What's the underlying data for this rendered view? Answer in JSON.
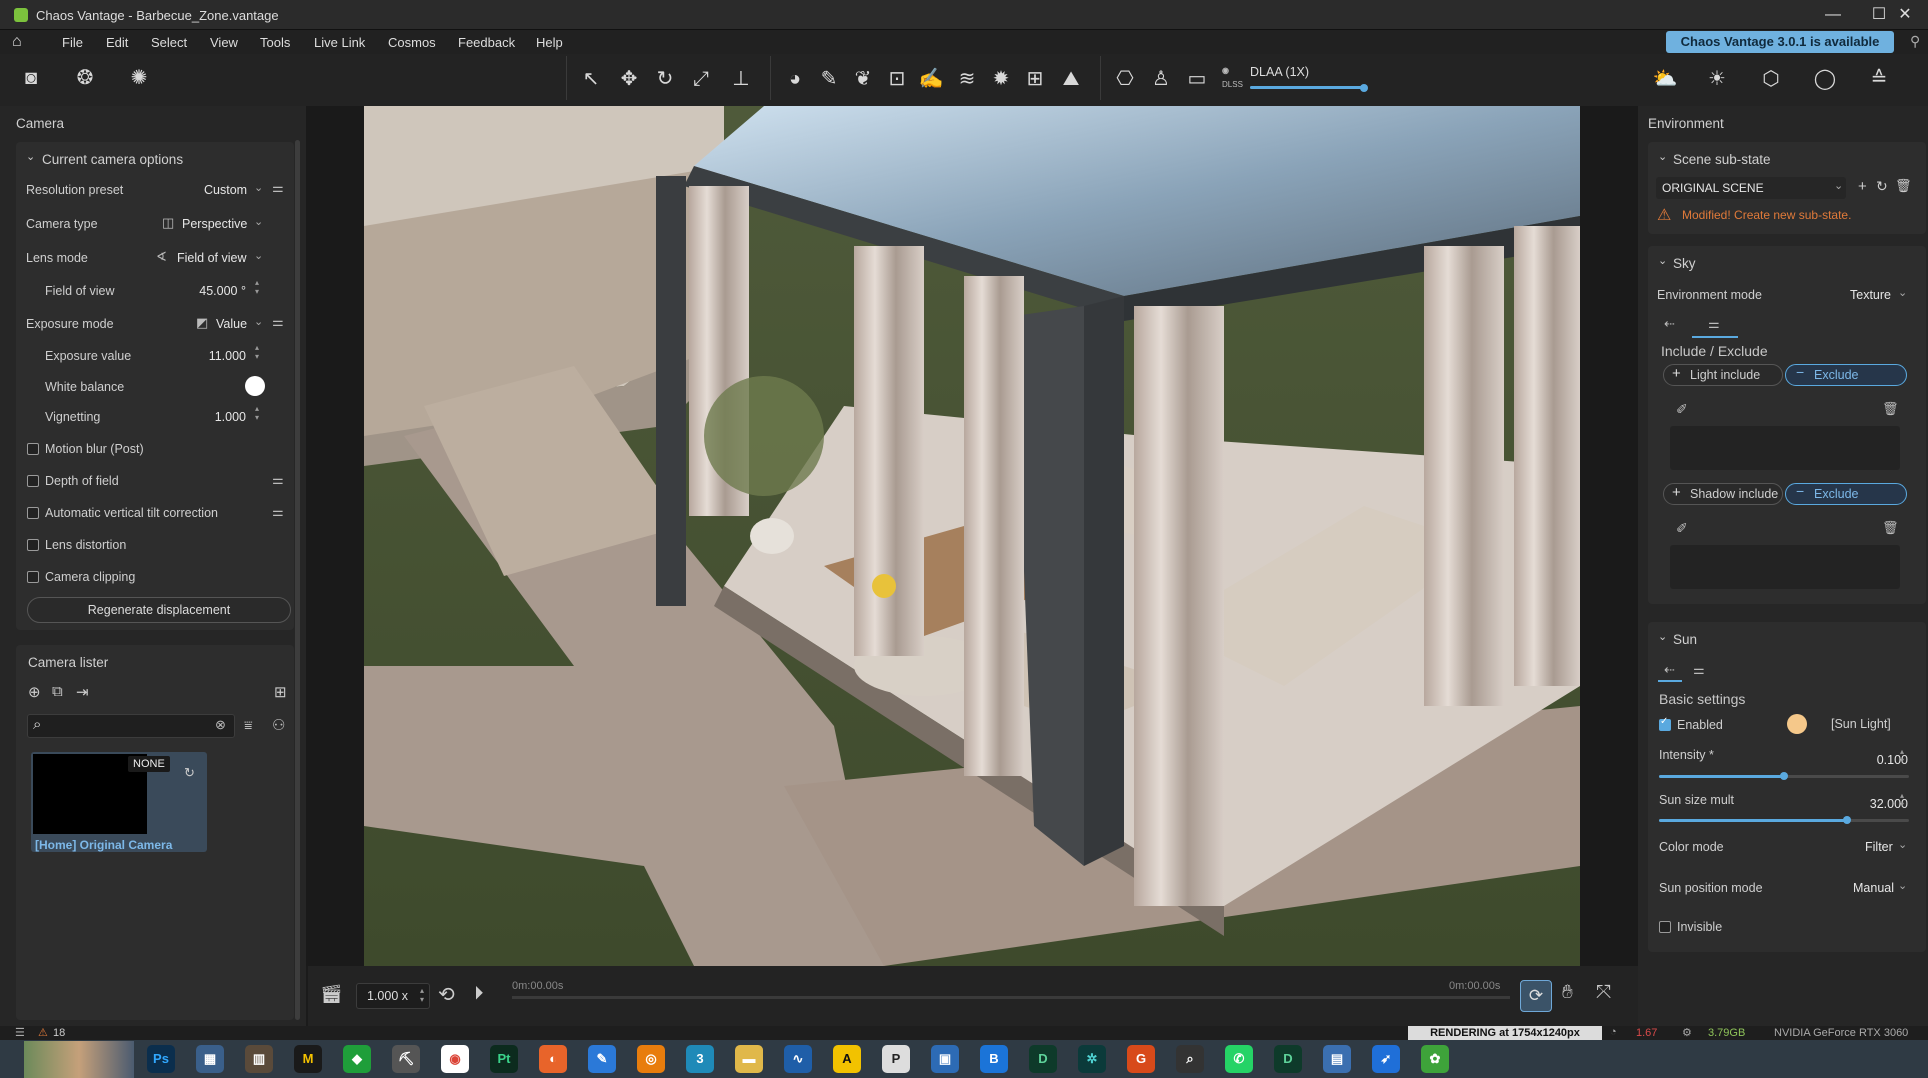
{
  "window": {
    "title": "Chaos Vantage - Barbecue_Zone.vantage"
  },
  "menu": [
    "File",
    "Edit",
    "Select",
    "View",
    "Tools",
    "Live Link",
    "Cosmos",
    "Feedback",
    "Help"
  ],
  "update_badge": "Chaos Vantage 3.0.1 is available",
  "toolbar": {
    "dlss_label": "DLAA (1X)",
    "dlss_small": "DLSS"
  },
  "left_panel": {
    "title": "Camera",
    "camera_options": {
      "header": "Current camera options",
      "rows": [
        {
          "label": "Resolution preset",
          "value": "Custom"
        },
        {
          "label": "Camera type",
          "value": "Perspective"
        },
        {
          "label": "Lens mode",
          "value": "Field of view"
        },
        {
          "label": "Field of view",
          "value": "45.000 °"
        },
        {
          "label": "Exposure mode",
          "value": "Value"
        },
        {
          "label": "Exposure value",
          "value": "11.000"
        },
        {
          "label": "White balance",
          "value": ""
        },
        {
          "label": "Vignetting",
          "value": "1.000"
        }
      ],
      "checkboxes": [
        "Motion blur (Post)",
        "Depth of field",
        "Automatic vertical tilt correction",
        "Lens distortion",
        "Camera clipping"
      ],
      "regen_button": "Regenerate displacement"
    },
    "lister": {
      "title": "Camera lister",
      "thumb_badge": "NONE",
      "thumb_caption": "[Home] Original Camera"
    }
  },
  "right_panel": {
    "title": "Environment",
    "substate": {
      "header": "Scene sub-state",
      "dropdown": "ORIGINAL SCENE",
      "warning": "Modified! Create new sub-state."
    },
    "sky": {
      "header": "Sky",
      "env_mode_label": "Environment mode",
      "env_mode_value": "Texture",
      "incl_title": "Include / Exclude",
      "light_include": "Light include",
      "shadow_include": "Shadow include",
      "exclude": "Exclude"
    },
    "sun": {
      "header": "Sun",
      "basic": "Basic settings",
      "enabled": "Enabled",
      "sun_light": "[Sun Light]",
      "intensity_label": "Intensity *",
      "intensity_value": "0.100",
      "intensity_level": 0.5,
      "size_label": "Sun size mult",
      "size_value": "32.000",
      "size_level": 0.75,
      "color_mode_label": "Color mode",
      "color_mode_value": "Filter",
      "sun_pos_label": "Sun position mode",
      "sun_pos_value": "Manual",
      "invisible": "Invisible"
    }
  },
  "timeline": {
    "speed": "1.000 x",
    "time_start": "0m:00.00s",
    "time_end": "0m:00.00s"
  },
  "status": {
    "warnings": "18",
    "rendering": "RENDERING at 1754x1240px",
    "fps": "1.67",
    "mem": "3.79GB",
    "gpu": "NVIDIA GeForce RTX 3060"
  },
  "colors": {
    "accent": "#5aa9df",
    "warning": "#e07a3a",
    "sun": "#f5c88a"
  }
}
